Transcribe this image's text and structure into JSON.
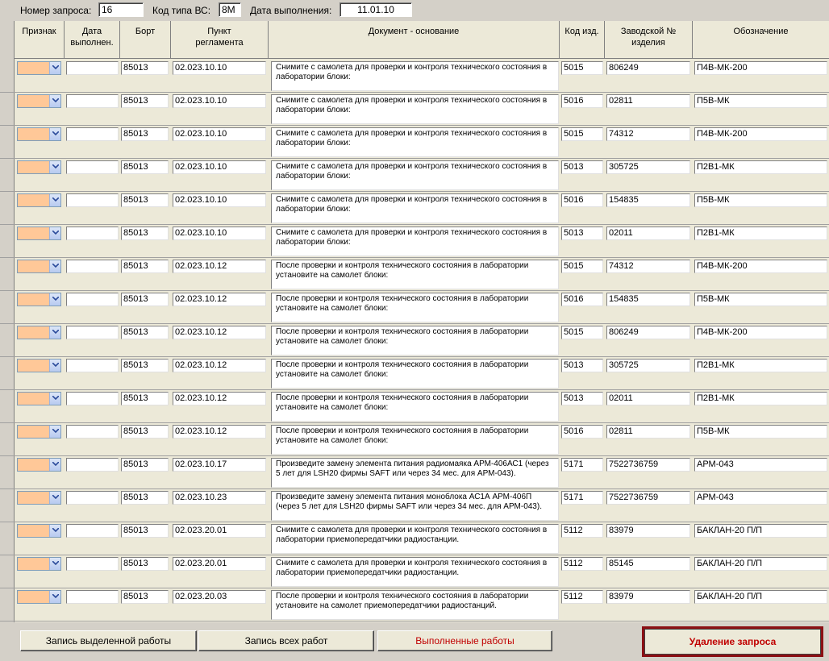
{
  "header": {
    "request_no_label": "Номер запроса:",
    "request_no_value": "16",
    "aircraft_type_label": "Код типа ВС:",
    "aircraft_type_value": "8М",
    "date_label": "Дата выполнения:",
    "date_value": "11.01.10"
  },
  "columns": {
    "sign": "Признак",
    "date_done": "Дата выполнен.",
    "board": "Борт",
    "reg_item": "Пункт регламента",
    "document": "Документ - основание",
    "item_code": "Код изд.",
    "serial": "Заводской № изделия",
    "designation": "Обозначение"
  },
  "rows": [
    {
      "board": "85013",
      "reg": "02.023.10.10",
      "doc": "Снимите с самолета для проверки и контроля технического состояния в лаборатории блоки:",
      "code": "5015",
      "serial": "806249",
      "des": "П4В-МК-200"
    },
    {
      "board": "85013",
      "reg": "02.023.10.10",
      "doc": "Снимите с самолета для проверки и контроля технического состояния в лаборатории блоки:",
      "code": "5016",
      "serial": "02811",
      "des": "П5В-МК"
    },
    {
      "board": "85013",
      "reg": "02.023.10.10",
      "doc": "Снимите с самолета для проверки и контроля технического состояния в лаборатории блоки:",
      "code": "5015",
      "serial": "74312",
      "des": "П4В-МК-200"
    },
    {
      "board": "85013",
      "reg": "02.023.10.10",
      "doc": "Снимите с самолета для проверки и контроля технического состояния в лаборатории блоки:",
      "code": "5013",
      "serial": "305725",
      "des": "П2В1-МК"
    },
    {
      "board": "85013",
      "reg": "02.023.10.10",
      "doc": "Снимите с самолета для проверки и контроля технического состояния в лаборатории блоки:",
      "code": "5016",
      "serial": "154835",
      "des": "П5В-МК"
    },
    {
      "board": "85013",
      "reg": "02.023.10.10",
      "doc": "Снимите с самолета для проверки и контроля технического состояния в лаборатории блоки:",
      "code": "5013",
      "serial": "02011",
      "des": "П2В1-МК"
    },
    {
      "board": "85013",
      "reg": "02.023.10.12",
      "doc": "После проверки и контроля технического состояния в лаборатории установите на самолет блоки:",
      "code": "5015",
      "serial": "74312",
      "des": "П4В-МК-200"
    },
    {
      "board": "85013",
      "reg": "02.023.10.12",
      "doc": "После проверки и контроля технического состояния в лаборатории установите на самолет блоки:",
      "code": "5016",
      "serial": "154835",
      "des": "П5В-МК"
    },
    {
      "board": "85013",
      "reg": "02.023.10.12",
      "doc": "После проверки и контроля технического состояния в лаборатории установите на самолет блоки:",
      "code": "5015",
      "serial": "806249",
      "des": "П4В-МК-200"
    },
    {
      "board": "85013",
      "reg": "02.023.10.12",
      "doc": "После проверки и контроля технического состояния в лаборатории установите на самолет блоки:",
      "code": "5013",
      "serial": "305725",
      "des": "П2В1-МК"
    },
    {
      "board": "85013",
      "reg": "02.023.10.12",
      "doc": "После проверки и контроля технического состояния в лаборатории установите на самолет блоки:",
      "code": "5013",
      "serial": "02011",
      "des": "П2В1-МК"
    },
    {
      "board": "85013",
      "reg": "02.023.10.12",
      "doc": "После проверки и контроля технического состояния в лаборатории установите на самолет блоки:",
      "code": "5016",
      "serial": "02811",
      "des": "П5В-МК"
    },
    {
      "board": "85013",
      "reg": "02.023.10.17",
      "doc": "Произведите замену элемента питания радиомаяка АРМ-406АС1 (через 5 лет для LSH20 фирмы SAFT или через 34 мес. для АРМ-043).",
      "code": "5171",
      "serial": "7522736759",
      "des": "АРМ-043"
    },
    {
      "board": "85013",
      "reg": "02.023.10.23",
      "doc": "Произведите замену элемента питания моноблока АС1А АРМ-406П (через 5 лет для LSH20 фирмы SAFT или через 34 мес. для АРМ-043).",
      "code": "5171",
      "serial": "7522736759",
      "des": "АРМ-043"
    },
    {
      "board": "85013",
      "reg": "02.023.20.01",
      "doc": "Снимите с самолета для проверки и контроля технического состояния в лаборатории приемопередатчики радиостанции.",
      "code": "5112",
      "serial": "83979",
      "des": "БАКЛАН-20 П/П"
    },
    {
      "board": "85013",
      "reg": "02.023.20.01",
      "doc": "Снимите с самолета для проверки и контроля технического состояния в лаборатории приемопередатчики радиостанции.",
      "code": "5112",
      "serial": "85145",
      "des": "БАКЛАН-20 П/П"
    },
    {
      "board": "85013",
      "reg": "02.023.20.03",
      "doc": "После проверки и контроля технического состояния в лаборатории установите на самолет приемопередатчики радиостанций.",
      "code": "5112",
      "serial": "83979",
      "des": "БАКЛАН-20 П/П"
    }
  ],
  "buttons": {
    "save_selected": "Запись выделенной работы",
    "save_all": "Запись всех работ",
    "completed": "Выполненные работы",
    "delete_request": "Удаление запроса"
  },
  "colors": {
    "combo_fill": "#ffc898",
    "danger_border": "#8b0f14",
    "danger_text": "#c00000"
  }
}
